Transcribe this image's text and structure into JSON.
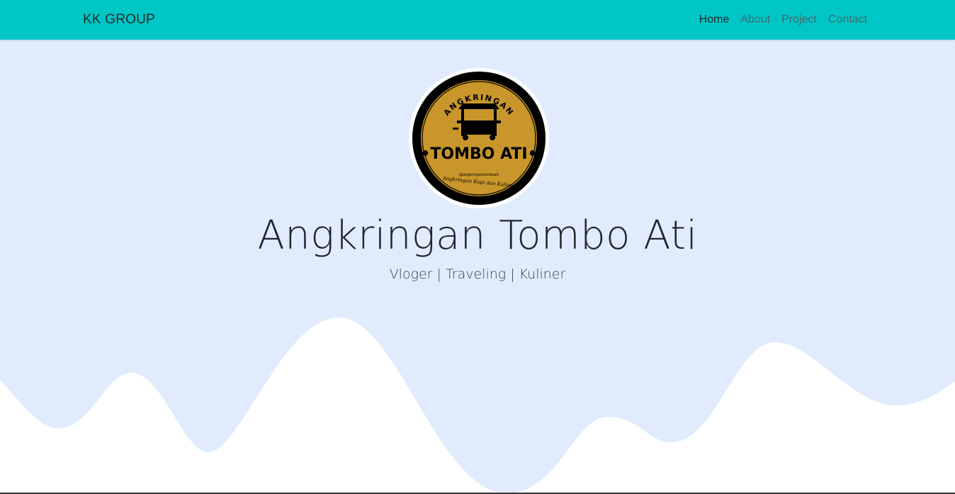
{
  "navbar": {
    "brand": "KK GROUP",
    "links": [
      {
        "label": "Home",
        "active": true
      },
      {
        "label": "About",
        "active": false
      },
      {
        "label": "Project",
        "active": false
      },
      {
        "label": "Contact",
        "active": false
      }
    ]
  },
  "hero": {
    "logo": {
      "top_text": "ANGKRINGAN",
      "main_text": "•TOMBO ATI•",
      "handle": "@angkringantomboati",
      "tagline": "Angkringan Kopi dan Kuliner"
    },
    "title": "Angkringan Tombo Ati",
    "subtitle": "Vloger | Traveling | Kuliner"
  },
  "colors": {
    "navbar_bg": "#00c6c6",
    "hero_bg": "#e0ecfd",
    "logo_gold": "#c8962a",
    "logo_black": "#000000"
  }
}
